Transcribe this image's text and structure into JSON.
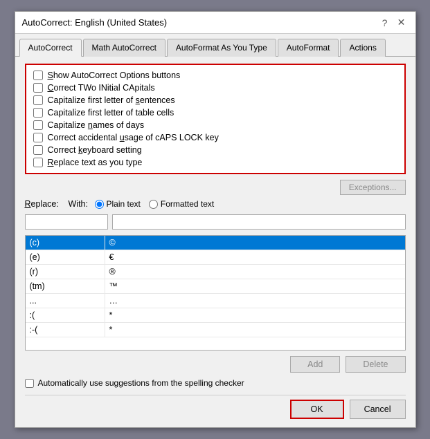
{
  "dialog": {
    "title": "AutoCorrect: English (United States)",
    "help_label": "?",
    "close_label": "✕"
  },
  "tabs": [
    {
      "label": "AutoCorrect",
      "active": true
    },
    {
      "label": "Math AutoCorrect",
      "active": false
    },
    {
      "label": "AutoFormat As You Type",
      "active": false
    },
    {
      "label": "AutoFormat",
      "active": false
    },
    {
      "label": "Actions",
      "active": false
    }
  ],
  "checkboxes": [
    {
      "id": "cb1",
      "label": "Show AutoCorrect Options buttons",
      "checked": false,
      "underline_char": "S"
    },
    {
      "id": "cb2",
      "label": "Correct TWo INitial CApitals",
      "checked": false,
      "underline_char": "C"
    },
    {
      "id": "cb3",
      "label": "Capitalize first letter of sentences",
      "checked": false,
      "underline_char": "a"
    },
    {
      "id": "cb4",
      "label": "Capitalize first letter of table cells",
      "checked": false,
      "underline_char": "f"
    },
    {
      "id": "cb5",
      "label": "Capitalize names of days",
      "checked": false,
      "underline_char": "n"
    },
    {
      "id": "cb6",
      "label": "Correct accidental usage of cAPS LOCK key",
      "checked": false,
      "underline_char": "u"
    },
    {
      "id": "cb7",
      "label": "Correct keyboard setting",
      "checked": false,
      "underline_char": "k"
    },
    {
      "id": "cb8",
      "label": "Replace text as you type",
      "checked": false,
      "underline_char": "R"
    }
  ],
  "exceptions_btn": "Exceptions...",
  "replace": {
    "label": "Replace:",
    "with_label": "With:",
    "radio_plain": "Plain text",
    "radio_formatted": "Formatted text",
    "left_value": "",
    "right_value": ""
  },
  "table_rows": [
    {
      "left": "(c)",
      "right": "©",
      "selected": true
    },
    {
      "left": "(e)",
      "right": "€",
      "selected": false
    },
    {
      "left": "(r)",
      "right": "®",
      "selected": false
    },
    {
      "left": "(tm)",
      "right": "™",
      "selected": false
    },
    {
      "left": "...",
      "right": "…",
      "selected": false
    },
    {
      "left": ":(",
      "right": "*",
      "selected": false
    },
    {
      "left": ":-( ",
      "right": "*",
      "selected": false
    }
  ],
  "add_btn": "Add",
  "delete_btn": "Delete",
  "spelling_checkbox": {
    "label": "Automatically use suggestions from the spelling checker",
    "checked": false
  },
  "ok_btn": "OK",
  "cancel_btn": "Cancel"
}
